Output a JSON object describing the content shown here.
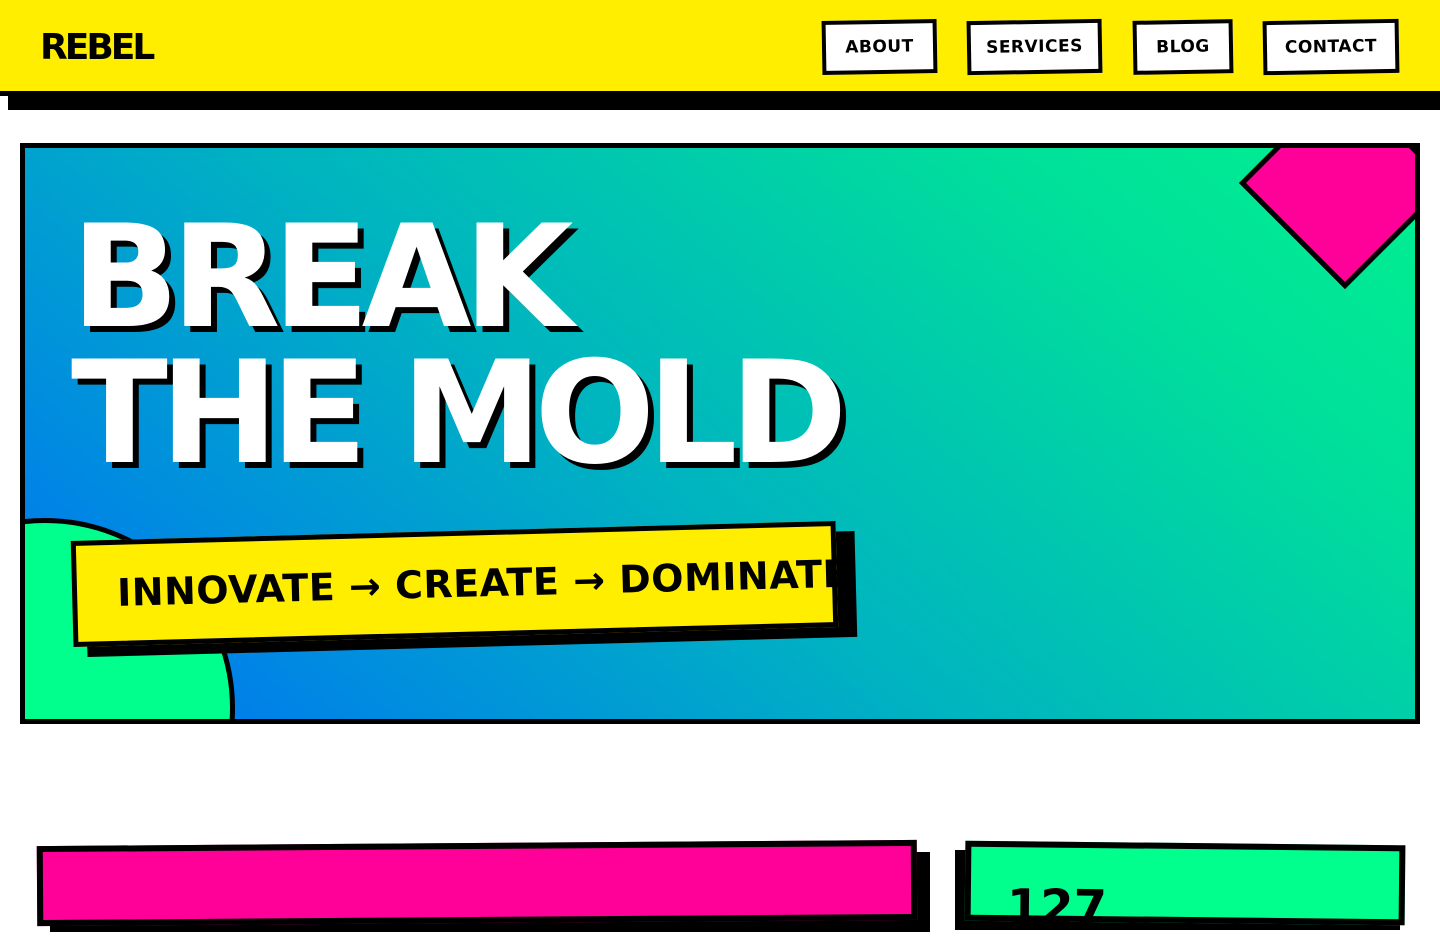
{
  "brand": {
    "logo": "REBEL"
  },
  "nav": {
    "items": [
      {
        "label": "ABOUT"
      },
      {
        "label": "SERVICES"
      },
      {
        "label": "BLOG"
      },
      {
        "label": "CONTACT"
      }
    ]
  },
  "hero": {
    "title_line1": "BREAK",
    "title_line2": "THE MOLD",
    "tagline": "INNOVATE → CREATE → DOMINATE"
  },
  "stats": {
    "first_number": "127"
  },
  "colors": {
    "yellow": "#ffee00",
    "pink": "#ff0099",
    "green": "#00ff8c",
    "blue": "#0070f5",
    "black": "#000000"
  }
}
